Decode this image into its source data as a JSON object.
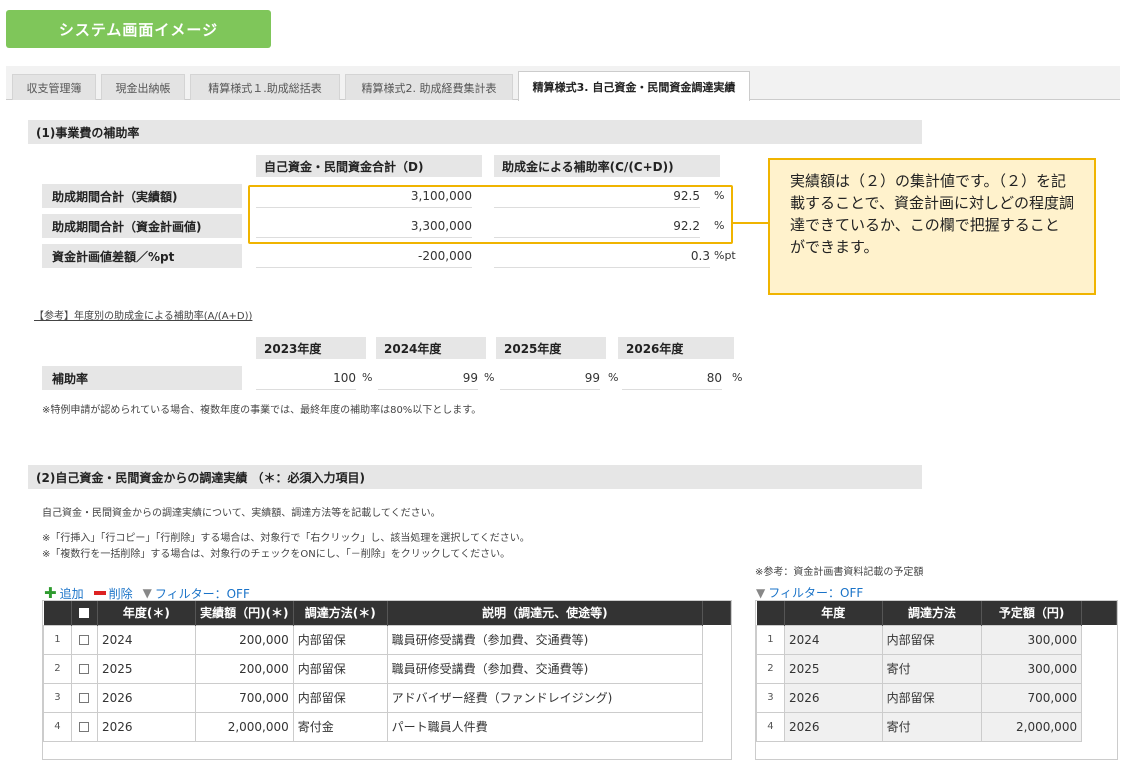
{
  "badge": "システム画面イメージ",
  "tabs": [
    "収支管理簿",
    "現金出納帳",
    "精算様式１.助成総括表",
    "精算様式2. 助成経費集計表",
    "精算様式3. 自己資金・民間資金調達実績"
  ],
  "s1": {
    "title": "(1)事業費の補助率",
    "col_d": "自己資金・民間資金合計（D)",
    "col_r": "助成金による補助率(C/(C+D))",
    "rows": [
      {
        "label": "助成期間合計（実績額)",
        "d": "3,100,000",
        "r": "92.5",
        "u": "%"
      },
      {
        "label": "助成期間合計（資金計画値)",
        "d": "3,300,000",
        "r": "92.2",
        "u": "%"
      },
      {
        "label": "資金計画値差額／%pt",
        "d": "-200,000",
        "r": "0.3",
        "u": "%pt"
      }
    ]
  },
  "callout": "実績額は（２）の集計値です。（２）を記載することで、資金計画に対しどの程度調達できているか、この欄で把握することができます。",
  "ref": {
    "title": "【参考】年度別の助成金による補助率(A/(A+D))",
    "years": [
      "2023年度",
      "2024年度",
      "2025年度",
      "2026年度"
    ],
    "label": "補助率",
    "values": [
      "100",
      "99",
      "99",
      "80"
    ],
    "unit": "%",
    "note": "※特例申請が認められている場合、複数年度の事業では、最終年度の補助率は80%以下とします。"
  },
  "s2": {
    "title": "(2)自己資金・民間資金からの調達実績 （＊：必須入力項目)",
    "desc": "自己資金・民間資金からの調達実績について、実績額、調達方法等を記載してください。",
    "note1": "※「行挿入」「行コピー」「行削除」する場合は、対象行で「右クリック」し、該当処理を選択してください。",
    "note2": "※「複数行を一括削除」する場合は、対象行のチェックをONにし、「－削除」をクリックしてください。",
    "add": "追加",
    "del": "削除",
    "filter": "フィルター：OFF",
    "headers": [
      "年度(＊)",
      "実績額（円)(＊)",
      "調達方法(＊)",
      "説明（調達元、使途等)"
    ],
    "rows": [
      {
        "idx": "1",
        "year": "2024",
        "amt": "200,000",
        "method": "内部留保",
        "desc": "職員研修受講費（参加費、交通費等)"
      },
      {
        "idx": "2",
        "year": "2025",
        "amt": "200,000",
        "method": "内部留保",
        "desc": "職員研修受講費（参加費、交通費等)"
      },
      {
        "idx": "3",
        "year": "2026",
        "amt": "700,000",
        "method": "内部留保",
        "desc": "アドバイザー経費（ファンドレイジング)"
      },
      {
        "idx": "4",
        "year": "2026",
        "amt": "2,000,000",
        "method": "寄付金",
        "desc": "パート職員人件費"
      }
    ]
  },
  "plan": {
    "note": "※参考：資金計画書資料記載の予定額",
    "filter": "フィルター：OFF",
    "headers": [
      "年度",
      "調達方法",
      "予定額（円)"
    ],
    "rows": [
      {
        "idx": "1",
        "year": "2024",
        "method": "内部留保",
        "amt": "300,000"
      },
      {
        "idx": "2",
        "year": "2025",
        "method": "寄付",
        "amt": "300,000"
      },
      {
        "idx": "3",
        "year": "2026",
        "method": "内部留保",
        "amt": "700,000"
      },
      {
        "idx": "4",
        "year": "2026",
        "method": "寄付",
        "amt": "2,000,000"
      }
    ]
  },
  "colors": {
    "badge": "#7fc65a",
    "highlight": "#f0b400",
    "callout_bg": "#fff2cc",
    "header": "#333333"
  }
}
